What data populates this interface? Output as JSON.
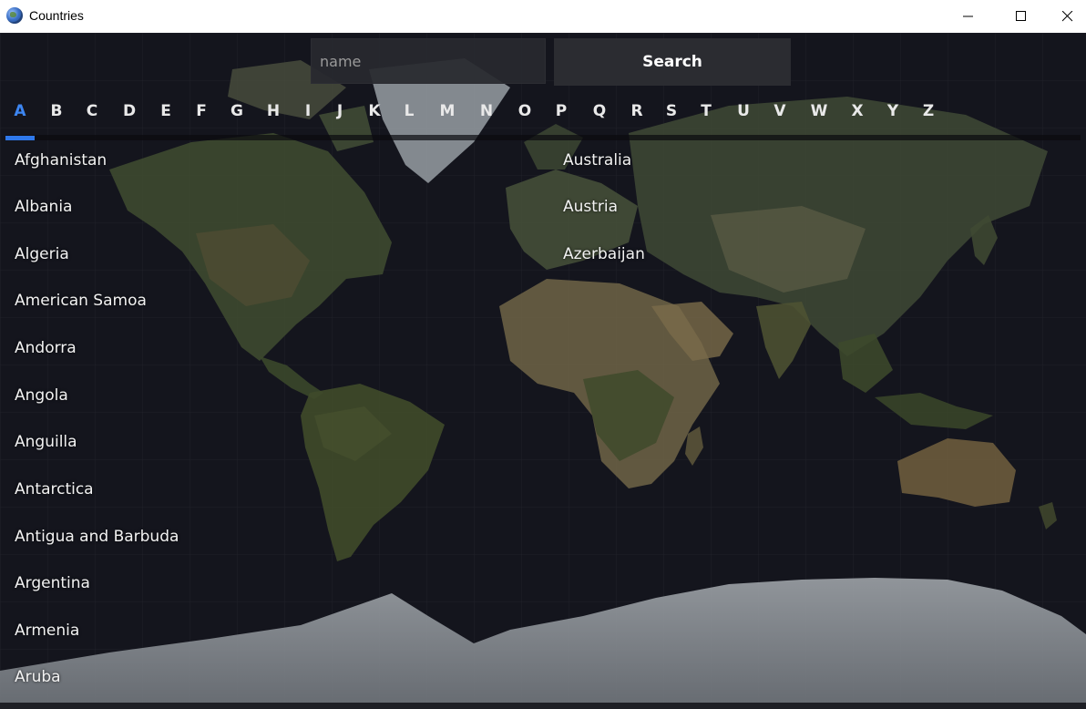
{
  "window": {
    "title": "Countries",
    "app_icon": "globe-icon",
    "controls": [
      "minimize-icon",
      "maximize-icon",
      "close-icon"
    ]
  },
  "search": {
    "placeholder": "name",
    "value": "",
    "button_label": "Search"
  },
  "tabs": {
    "letters": [
      "A",
      "B",
      "C",
      "D",
      "E",
      "F",
      "G",
      "H",
      "I",
      "J",
      "K",
      "L",
      "M",
      "N",
      "O",
      "P",
      "Q",
      "R",
      "S",
      "T",
      "U",
      "V",
      "W",
      "X",
      "Y",
      "Z"
    ],
    "active": "A",
    "active_color": "#3d86f2"
  },
  "countries": {
    "left_column": [
      "Afghanistan",
      "Albania",
      "Algeria",
      "American Samoa",
      "Andorra",
      "Angola",
      "Anguilla",
      "Antarctica",
      "Antigua and Barbuda",
      "Argentina",
      "Armenia",
      "Aruba"
    ],
    "right_column": [
      "Australia",
      "Austria",
      "Azerbaijan"
    ]
  },
  "background": {
    "image": "world-map",
    "color": "#15161f"
  }
}
